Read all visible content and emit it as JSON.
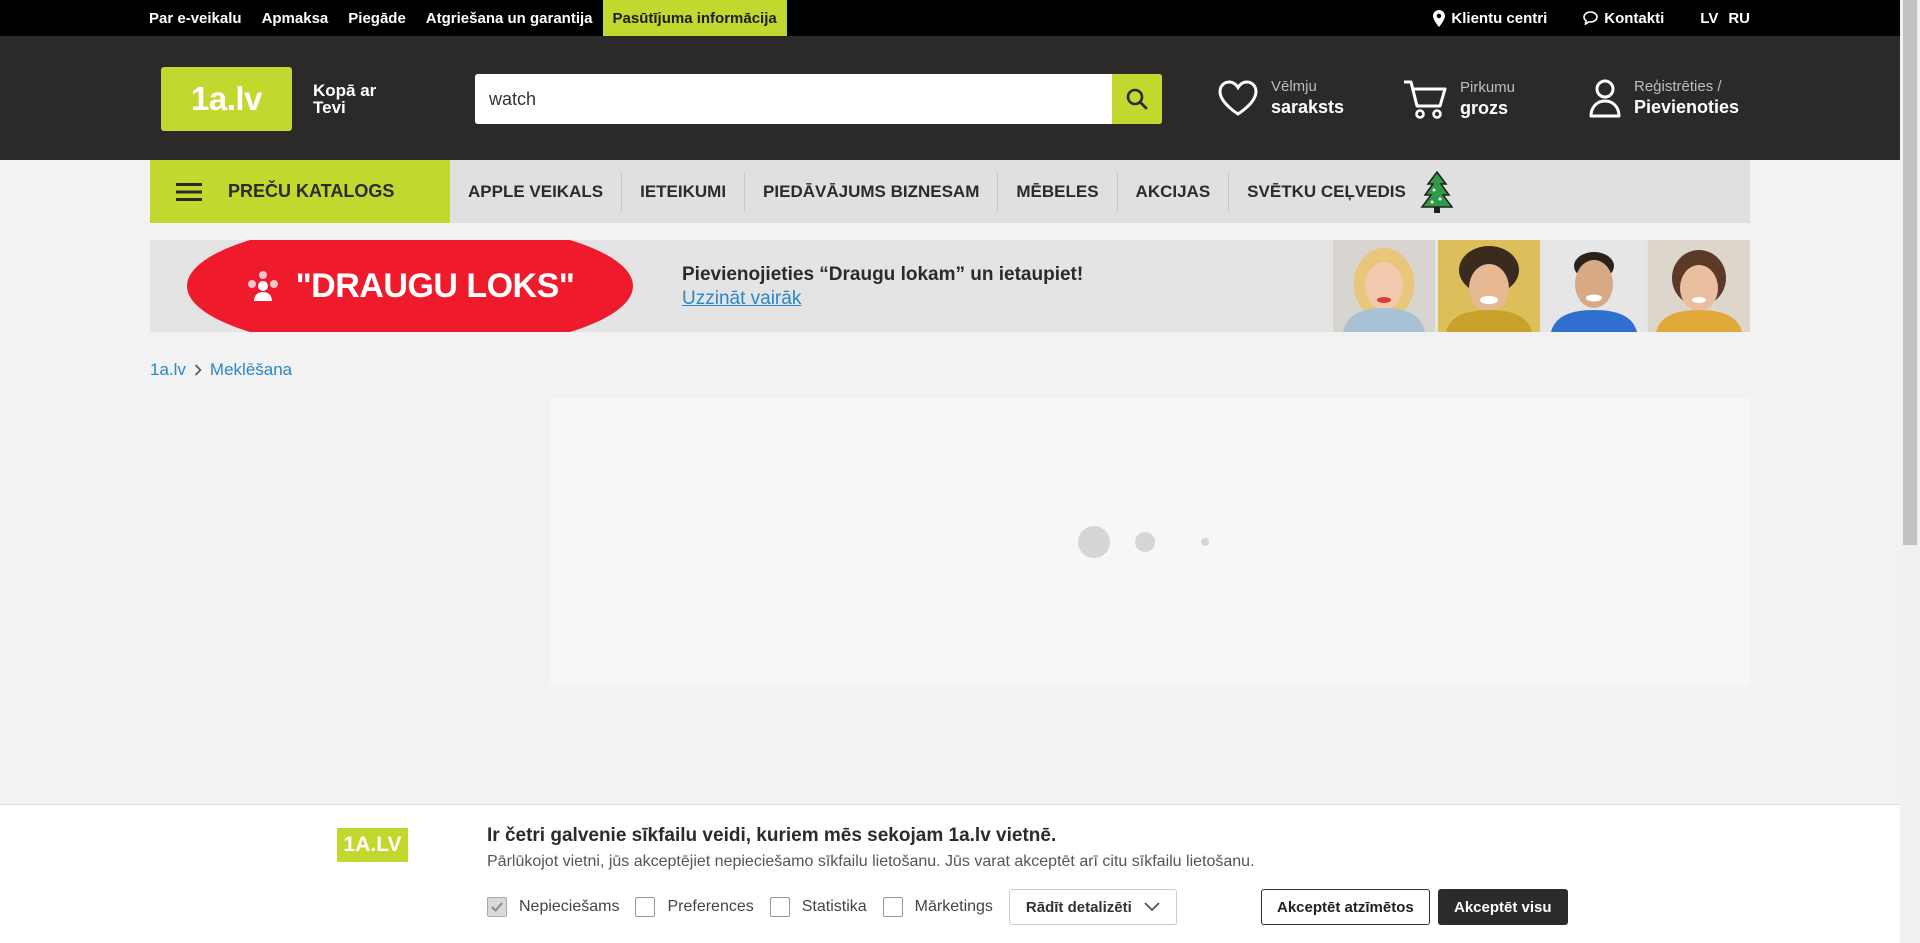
{
  "topbar": {
    "links": [
      "Par e-veikalu",
      "Apmaksa",
      "Piegāde",
      "Atgriešana un garantija",
      "Pasūtījuma informācija"
    ],
    "clients": "Klientu centri",
    "contacts": "Kontakti",
    "lang_lv": "LV",
    "lang_ru": "RU"
  },
  "header": {
    "logo": "1a.lv",
    "slogan": "Kopā ar Tevi",
    "search_value": "watch",
    "wishlist_line1": "Vēlmju",
    "wishlist_line2": "saraksts",
    "cart_line1": "Pirkumu",
    "cart_line2": "grozs",
    "account_line1": "Reģistrēties /",
    "account_line2": "Pievienoties"
  },
  "nav": {
    "catalog": "PREČU KATALOGS",
    "links": [
      "APPLE VEIKALS",
      "IETEIKUMI",
      "PIEDĀVĀJUMS BIZNESAM",
      "MĒBELES",
      "AKCIJAS",
      "SVĒTKU CEĻVEDIS"
    ]
  },
  "banner": {
    "title": "\"DRAUGU LOKS\"",
    "message": "Pievienojieties “Draugu lokam” un ietaupiet!",
    "link": "Uzzināt vairāk"
  },
  "breadcrumb": {
    "home": "1a.lv",
    "current": "Meklēšana"
  },
  "cookie": {
    "logo": "1A.LV",
    "title": "Ir četri galvenie sīkfailu veidi, kuriem mēs sekojam 1a.lv vietnē.",
    "description": "Pārlūkojot vietni, jūs akceptējiet nepieciešamo sīkfailu lietošanu. Jūs varat akceptēt arī citu sīkfailu lietošanu.",
    "options": [
      "Nepieciešams",
      "Preferences",
      "Statistika",
      "Mārketings"
    ],
    "details": "Rādīt detalizēti",
    "accept_selected": "Akceptēt atzīmētos",
    "accept_all": "Akceptēt visu"
  },
  "colors": {
    "brand_green": "#c3d82e",
    "header_dark": "#2b2a29",
    "banner_red": "#ef1b2d",
    "link_blue": "#2b87c8"
  }
}
